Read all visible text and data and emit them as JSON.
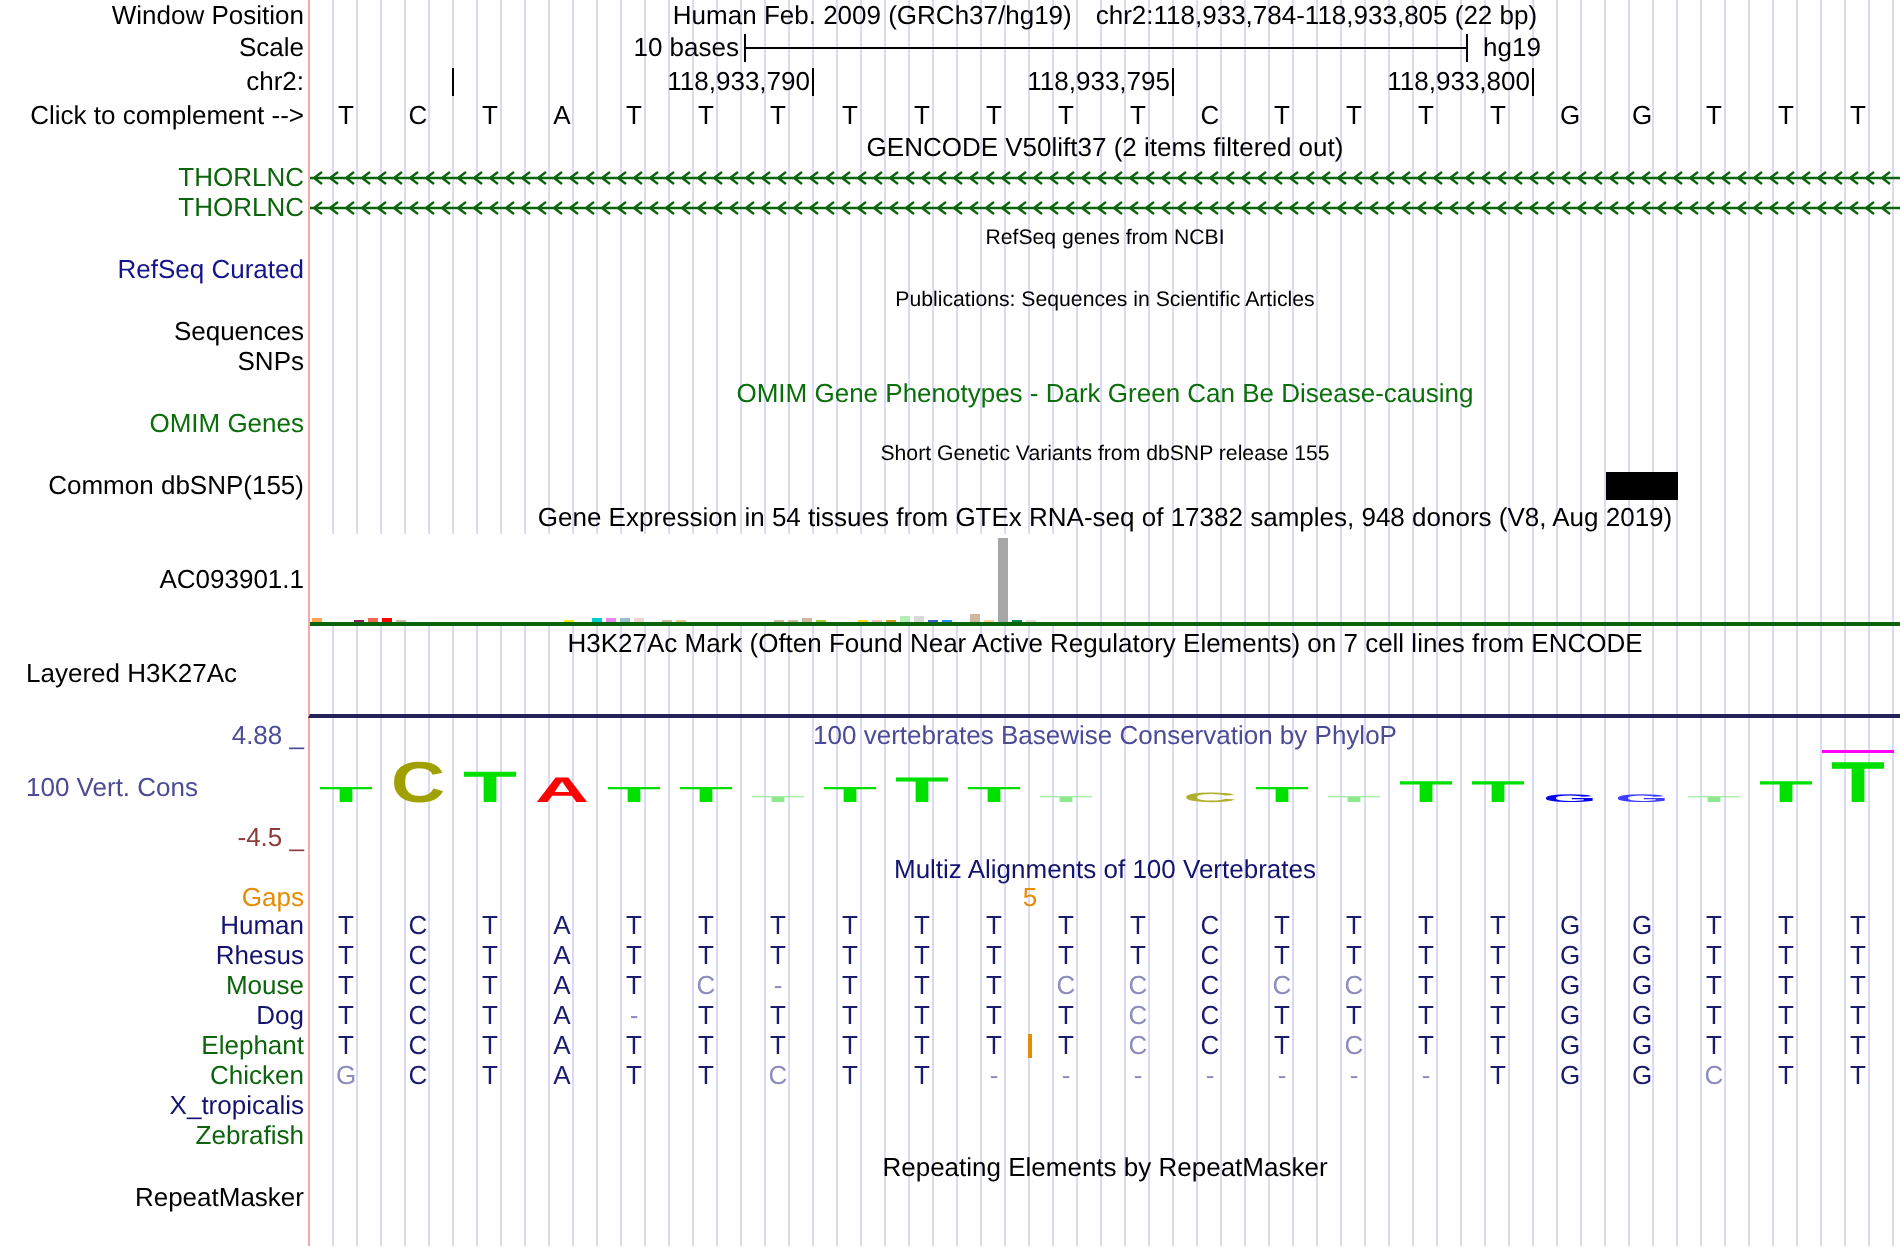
{
  "position": {
    "label": "Window Position",
    "assembly": "Human Feb. 2009 (GRCh37/hg19)",
    "range": "chr2:118,933,784-118,933,805 (22 bp)"
  },
  "scale": {
    "label": "Scale",
    "length": "10 bases",
    "assembly": "hg19"
  },
  "ruler": {
    "label": "chr2:",
    "marks": [
      {
        "tick": false
      },
      {
        "tick": true
      },
      {
        "tick": false
      },
      {
        "tick": false
      },
      {
        "tick": false
      },
      {
        "tick": false
      },
      {
        "tick": true,
        "text": "118,933,790"
      },
      {
        "tick": false
      },
      {
        "tick": false
      },
      {
        "tick": false
      },
      {
        "tick": false
      },
      {
        "tick": true,
        "text": "118,933,795"
      },
      {
        "tick": false
      },
      {
        "tick": false
      },
      {
        "tick": false
      },
      {
        "tick": false
      },
      {
        "tick": true,
        "text": "118,933,800"
      },
      {
        "tick": false
      },
      {
        "tick": false
      },
      {
        "tick": false
      },
      {
        "tick": false
      },
      {
        "tick": false
      }
    ]
  },
  "sequence": {
    "label": "Click to complement -->",
    "bases": [
      "T",
      "C",
      "T",
      "A",
      "T",
      "T",
      "T",
      "T",
      "T",
      "T",
      "T",
      "T",
      "C",
      "T",
      "T",
      "T",
      "T",
      "G",
      "G",
      "T",
      "T",
      "T"
    ]
  },
  "tracks": [
    {
      "kind": "genes",
      "title": "GENCODE V50lift37 (2 items filtered out)",
      "small_title": false,
      "color": "#000000",
      "rows": [
        {
          "label": "THORLNC",
          "color": "#0c640c",
          "reverse": true
        },
        {
          "label": "THORLNC",
          "color": "#0c640c",
          "reverse": true
        }
      ]
    },
    {
      "kind": "labels",
      "title": "RefSeq genes from NCBI",
      "small_title": true,
      "color": "#000000",
      "rows": [
        {
          "label": "RefSeq Curated",
          "color": "#14148c"
        }
      ]
    },
    {
      "kind": "labels",
      "title": "Publications: Sequences in Scientific Articles",
      "small_title": true,
      "color": "#000000",
      "rows": [
        {
          "label": "Sequences",
          "color": "#000000"
        },
        {
          "label": "SNPs",
          "color": "#000000"
        }
      ]
    },
    {
      "kind": "labels",
      "title": "OMIM Gene Phenotypes - Dark Green Can Be Disease-causing",
      "small_title": false,
      "color": "#0a6e0a",
      "rows": [
        {
          "label": "OMIM Genes",
          "color": "#0a6e0a"
        }
      ]
    },
    {
      "kind": "variants",
      "title": "Short Genetic Variants from dbSNP release 155",
      "small_title": true,
      "color": "#000000",
      "rows": [
        {
          "label": "Common dbSNP(155)",
          "color": "#000000",
          "sites": [
            {
              "variant": false
            },
            {
              "variant": false
            },
            {
              "variant": false
            },
            {
              "variant": false
            },
            {
              "variant": false
            },
            {
              "variant": false
            },
            {
              "variant": false
            },
            {
              "variant": false
            },
            {
              "variant": false
            },
            {
              "variant": false
            },
            {
              "variant": false
            },
            {
              "variant": false
            },
            {
              "variant": false
            },
            {
              "variant": false
            },
            {
              "variant": false
            },
            {
              "variant": false
            },
            {
              "variant": false
            },
            {
              "variant": false
            },
            {
              "variant": true
            },
            {
              "variant": false
            },
            {
              "variant": false
            },
            {
              "variant": false
            }
          ]
        }
      ]
    },
    {
      "kind": "expression",
      "title": "Gene Expression in 54 tissues from GTEx RNA-seq of 17382 samples, 948 donors (V8, Aug 2019)",
      "small_title": false,
      "color": "#000000",
      "rows": [
        {
          "label": "AC093901.1",
          "color": "#000000"
        }
      ]
    },
    {
      "kind": "signal",
      "title": "H3K27Ac Mark (Often Found Near Active Regulatory Elements) on 7 cell lines from ENCODE",
      "small_title": false,
      "color": "#000000",
      "rows": [
        {
          "label": "Layered H3K27Ac",
          "color": "#000000"
        }
      ]
    },
    {
      "kind": "conservation",
      "title": "100 vertebrates Basewise Conservation by PhyloP",
      "small_title": false,
      "color": "#4b4b96",
      "max": {
        "text": "4.88 _",
        "color": "#4b4b96"
      },
      "min": {
        "text": "-4.5 _",
        "color": "#8c3c3c"
      },
      "rows": [
        {
          "label": "100 Vert. Cons",
          "color": "#4b4b96",
          "letters": [
            {
              "kind": "letter",
              "base": "T",
              "color": "#00e000",
              "clipped": false
            },
            {
              "kind": "letter",
              "base": "C",
              "color": "#a0a000",
              "clipped": false
            },
            {
              "kind": "letter",
              "base": "T",
              "color": "#00e000",
              "clipped": false
            },
            {
              "kind": "letter",
              "base": "A",
              "color": "#ff0000",
              "clipped": false
            },
            {
              "kind": "letter",
              "base": "T",
              "color": "#00e000",
              "clipped": false
            },
            {
              "kind": "letter",
              "base": "T",
              "color": "#00e000",
              "clipped": false
            },
            {
              "kind": "letter",
              "base": "T",
              "color": "#8ee88e",
              "clipped": false
            },
            {
              "kind": "letter",
              "base": "T",
              "color": "#00e000",
              "clipped": false
            },
            {
              "kind": "letter",
              "base": "T",
              "color": "#00e000",
              "clipped": false
            },
            {
              "kind": "letter",
              "base": "T",
              "color": "#00e000",
              "clipped": false
            },
            {
              "kind": "letter",
              "base": "T",
              "color": "#8ee88e",
              "clipped": false
            },
            {
              "kind": "blank"
            },
            {
              "kind": "letter",
              "base": "C",
              "color": "#b0b030",
              "clipped": false
            },
            {
              "kind": "letter",
              "base": "T",
              "color": "#00e000",
              "clipped": false
            },
            {
              "kind": "letter",
              "base": "T",
              "color": "#8ee88e",
              "clipped": false
            },
            {
              "kind": "letter",
              "base": "T",
              "color": "#00e000",
              "clipped": false
            },
            {
              "kind": "letter",
              "base": "T",
              "color": "#00e000",
              "clipped": false
            },
            {
              "kind": "letter",
              "base": "G",
              "color": "#0000ee",
              "clipped": false
            },
            {
              "kind": "letter",
              "base": "G",
              "color": "#3c3cff",
              "clipped": false
            },
            {
              "kind": "letter",
              "base": "T",
              "color": "#8ee88e",
              "clipped": false
            },
            {
              "kind": "letter",
              "base": "T",
              "color": "#00e000",
              "clipped": false
            },
            {
              "kind": "letter",
              "base": "T",
              "color": "#00e000",
              "clipped": true
            }
          ]
        }
      ]
    },
    {
      "kind": "alignment",
      "title": "Multiz Alignments of 100 Vertebrates",
      "small_title": false,
      "color": "#14146e",
      "gaps": {
        "label": "Gaps",
        "color": "#e68c00",
        "cells": [
          {
            "kind": "space"
          },
          {
            "kind": "space"
          },
          {
            "kind": "space"
          },
          {
            "kind": "space"
          },
          {
            "kind": "space"
          },
          {
            "kind": "space"
          },
          {
            "kind": "space"
          },
          {
            "kind": "space"
          },
          {
            "kind": "space"
          },
          {
            "kind": "space"
          },
          {
            "kind": "count",
            "text": "5"
          },
          {
            "kind": "space"
          },
          {
            "kind": "space"
          },
          {
            "kind": "space"
          },
          {
            "kind": "space"
          },
          {
            "kind": "space"
          },
          {
            "kind": "space"
          },
          {
            "kind": "space"
          },
          {
            "kind": "space"
          },
          {
            "kind": "space"
          },
          {
            "kind": "space"
          },
          {
            "kind": "space"
          },
          {
            "kind": "space"
          }
        ]
      },
      "rows": [
        {
          "label": "Human",
          "color": "#14146e",
          "cells": [
            {
              "base": "T",
              "mismatch": false
            },
            {
              "base": "C",
              "mismatch": false
            },
            {
              "base": "T",
              "mismatch": false
            },
            {
              "base": "A",
              "mismatch": false
            },
            {
              "base": "T",
              "mismatch": false
            },
            {
              "base": "T",
              "mismatch": false
            },
            {
              "base": "T",
              "mismatch": false
            },
            {
              "base": "T",
              "mismatch": false
            },
            {
              "base": "T",
              "mismatch": false
            },
            {
              "base": "T",
              "mismatch": false
            },
            {
              "base": "T",
              "mismatch": false
            },
            {
              "base": "T",
              "mismatch": false
            },
            {
              "base": "C",
              "mismatch": false
            },
            {
              "base": "T",
              "mismatch": false
            },
            {
              "base": "T",
              "mismatch": false
            },
            {
              "base": "T",
              "mismatch": false
            },
            {
              "base": "T",
              "mismatch": false
            },
            {
              "base": "G",
              "mismatch": false
            },
            {
              "base": "G",
              "mismatch": false
            },
            {
              "base": "T",
              "mismatch": false
            },
            {
              "base": "T",
              "mismatch": false
            },
            {
              "base": "T",
              "mismatch": false
            }
          ]
        },
        {
          "label": "Rhesus",
          "color": "#14146e",
          "cells": [
            {
              "base": "T",
              "mismatch": false
            },
            {
              "base": "C",
              "mismatch": false
            },
            {
              "base": "T",
              "mismatch": false
            },
            {
              "base": "A",
              "mismatch": false
            },
            {
              "base": "T",
              "mismatch": false
            },
            {
              "base": "T",
              "mismatch": false
            },
            {
              "base": "T",
              "mismatch": false
            },
            {
              "base": "T",
              "mismatch": false
            },
            {
              "base": "T",
              "mismatch": false
            },
            {
              "base": "T",
              "mismatch": false
            },
            {
              "base": "T",
              "mismatch": false
            },
            {
              "base": "T",
              "mismatch": false
            },
            {
              "base": "C",
              "mismatch": false
            },
            {
              "base": "T",
              "mismatch": false
            },
            {
              "base": "T",
              "mismatch": false
            },
            {
              "base": "T",
              "mismatch": false
            },
            {
              "base": "T",
              "mismatch": false
            },
            {
              "base": "G",
              "mismatch": false
            },
            {
              "base": "G",
              "mismatch": false
            },
            {
              "base": "T",
              "mismatch": false
            },
            {
              "base": "T",
              "mismatch": false
            },
            {
              "base": "T",
              "mismatch": false
            }
          ]
        },
        {
          "label": "Mouse",
          "color": "#0c640c",
          "cells": [
            {
              "base": "T",
              "mismatch": false
            },
            {
              "base": "C",
              "mismatch": false
            },
            {
              "base": "T",
              "mismatch": false
            },
            {
              "base": "A",
              "mismatch": false
            },
            {
              "base": "T",
              "mismatch": false
            },
            {
              "base": "C",
              "mismatch": true
            },
            {
              "base": "-",
              "mismatch": true
            },
            {
              "base": "T",
              "mismatch": false
            },
            {
              "base": "T",
              "mismatch": false
            },
            {
              "base": "T",
              "mismatch": false
            },
            {
              "base": "C",
              "mismatch": true
            },
            {
              "base": "C",
              "mismatch": true
            },
            {
              "base": "C",
              "mismatch": false
            },
            {
              "base": "C",
              "mismatch": true
            },
            {
              "base": "C",
              "mismatch": true
            },
            {
              "base": "T",
              "mismatch": false
            },
            {
              "base": "T",
              "mismatch": false
            },
            {
              "base": "G",
              "mismatch": false
            },
            {
              "base": "G",
              "mismatch": false
            },
            {
              "base": "T",
              "mismatch": false
            },
            {
              "base": "T",
              "mismatch": false
            },
            {
              "base": "T",
              "mismatch": false
            }
          ]
        },
        {
          "label": "Dog",
          "color": "#14146e",
          "cells": [
            {
              "base": "T",
              "mismatch": false
            },
            {
              "base": "C",
              "mismatch": false
            },
            {
              "base": "T",
              "mismatch": false
            },
            {
              "base": "A",
              "mismatch": false
            },
            {
              "base": "-",
              "mismatch": true
            },
            {
              "base": "T",
              "mismatch": false
            },
            {
              "base": "T",
              "mismatch": false
            },
            {
              "base": "T",
              "mismatch": false
            },
            {
              "base": "T",
              "mismatch": false
            },
            {
              "base": "T",
              "mismatch": false
            },
            {
              "base": "T",
              "mismatch": false
            },
            {
              "base": "C",
              "mismatch": true
            },
            {
              "base": "C",
              "mismatch": false
            },
            {
              "base": "T",
              "mismatch": false
            },
            {
              "base": "T",
              "mismatch": false
            },
            {
              "base": "T",
              "mismatch": false
            },
            {
              "base": "T",
              "mismatch": false
            },
            {
              "base": "G",
              "mismatch": false
            },
            {
              "base": "G",
              "mismatch": false
            },
            {
              "base": "T",
              "mismatch": false
            },
            {
              "base": "T",
              "mismatch": false
            },
            {
              "base": "T",
              "mismatch": false
            }
          ]
        },
        {
          "label": "Elephant",
          "color": "#0c640c",
          "cells": [
            {
              "kind": "base",
              "base": "T",
              "mismatch": false
            },
            {
              "kind": "base",
              "base": "C",
              "mismatch": false
            },
            {
              "kind": "base",
              "base": "T",
              "mismatch": false
            },
            {
              "kind": "base",
              "base": "A",
              "mismatch": false
            },
            {
              "kind": "base",
              "base": "T",
              "mismatch": false
            },
            {
              "kind": "base",
              "base": "T",
              "mismatch": false
            },
            {
              "kind": "base",
              "base": "T",
              "mismatch": false
            },
            {
              "kind": "base",
              "base": "T",
              "mismatch": false
            },
            {
              "kind": "base",
              "base": "T",
              "mismatch": false
            },
            {
              "kind": "base",
              "base": "T",
              "mismatch": false
            },
            {
              "kind": "insertion"
            },
            {
              "kind": "base",
              "base": "T",
              "mismatch": false
            },
            {
              "kind": "base",
              "base": "C",
              "mismatch": true
            },
            {
              "kind": "base",
              "base": "C",
              "mismatch": false
            },
            {
              "kind": "base",
              "base": "T",
              "mismatch": false
            },
            {
              "kind": "base",
              "base": "C",
              "mismatch": true
            },
            {
              "kind": "base",
              "base": "T",
              "mismatch": false
            },
            {
              "kind": "base",
              "base": "T",
              "mismatch": false
            },
            {
              "kind": "base",
              "base": "G",
              "mismatch": false
            },
            {
              "kind": "base",
              "base": "G",
              "mismatch": false
            },
            {
              "kind": "base",
              "base": "T",
              "mismatch": false
            },
            {
              "kind": "base",
              "base": "T",
              "mismatch": false
            },
            {
              "kind": "base",
              "base": "T",
              "mismatch": false
            }
          ]
        },
        {
          "label": "Chicken",
          "color": "#0c640c",
          "cells": [
            {
              "base": "G",
              "mismatch": true
            },
            {
              "base": "C",
              "mismatch": false
            },
            {
              "base": "T",
              "mismatch": false
            },
            {
              "base": "A",
              "mismatch": false
            },
            {
              "base": "T",
              "mismatch": false
            },
            {
              "base": "T",
              "mismatch": false
            },
            {
              "base": "C",
              "mismatch": true
            },
            {
              "base": "T",
              "mismatch": false
            },
            {
              "base": "T",
              "mismatch": false
            },
            {
              "base": "-",
              "mismatch": true
            },
            {
              "base": "-",
              "mismatch": true
            },
            {
              "base": "-",
              "mismatch": true
            },
            {
              "base": "-",
              "mismatch": true
            },
            {
              "base": "-",
              "mismatch": true
            },
            {
              "base": "-",
              "mismatch": true
            },
            {
              "base": "-",
              "mismatch": true
            },
            {
              "base": "T",
              "mismatch": false
            },
            {
              "base": "G",
              "mismatch": false
            },
            {
              "base": "G",
              "mismatch": false
            },
            {
              "base": "C",
              "mismatch": true
            },
            {
              "base": "T",
              "mismatch": false
            },
            {
              "base": "T",
              "mismatch": false
            }
          ]
        },
        {
          "label": "X_tropicalis",
          "color": "#14146e"
        },
        {
          "label": "Zebrafish",
          "color": "#0c640c"
        }
      ]
    },
    {
      "kind": "labels",
      "title": "Repeating Elements by RepeatMasker",
      "small_title": false,
      "color": "#000000",
      "rows": [
        {
          "label": "RepeatMasker",
          "color": "#000000"
        }
      ]
    }
  ]
}
